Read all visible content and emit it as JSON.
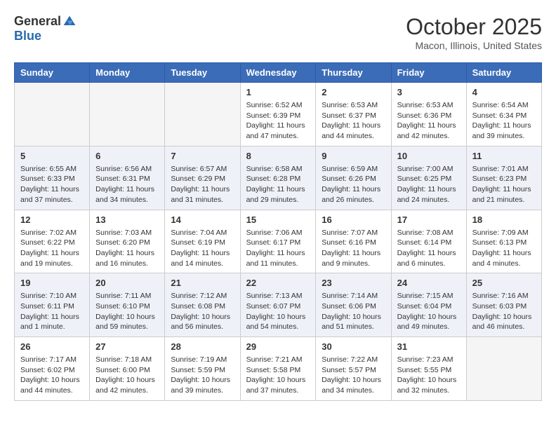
{
  "logo": {
    "general": "General",
    "blue": "Blue"
  },
  "title": "October 2025",
  "location": "Macon, Illinois, United States",
  "days_of_week": [
    "Sunday",
    "Monday",
    "Tuesday",
    "Wednesday",
    "Thursday",
    "Friday",
    "Saturday"
  ],
  "weeks": [
    [
      {
        "day": "",
        "info": ""
      },
      {
        "day": "",
        "info": ""
      },
      {
        "day": "",
        "info": ""
      },
      {
        "day": "1",
        "info": "Sunrise: 6:52 AM\nSunset: 6:39 PM\nDaylight: 11 hours and 47 minutes."
      },
      {
        "day": "2",
        "info": "Sunrise: 6:53 AM\nSunset: 6:37 PM\nDaylight: 11 hours and 44 minutes."
      },
      {
        "day": "3",
        "info": "Sunrise: 6:53 AM\nSunset: 6:36 PM\nDaylight: 11 hours and 42 minutes."
      },
      {
        "day": "4",
        "info": "Sunrise: 6:54 AM\nSunset: 6:34 PM\nDaylight: 11 hours and 39 minutes."
      }
    ],
    [
      {
        "day": "5",
        "info": "Sunrise: 6:55 AM\nSunset: 6:33 PM\nDaylight: 11 hours and 37 minutes."
      },
      {
        "day": "6",
        "info": "Sunrise: 6:56 AM\nSunset: 6:31 PM\nDaylight: 11 hours and 34 minutes."
      },
      {
        "day": "7",
        "info": "Sunrise: 6:57 AM\nSunset: 6:29 PM\nDaylight: 11 hours and 31 minutes."
      },
      {
        "day": "8",
        "info": "Sunrise: 6:58 AM\nSunset: 6:28 PM\nDaylight: 11 hours and 29 minutes."
      },
      {
        "day": "9",
        "info": "Sunrise: 6:59 AM\nSunset: 6:26 PM\nDaylight: 11 hours and 26 minutes."
      },
      {
        "day": "10",
        "info": "Sunrise: 7:00 AM\nSunset: 6:25 PM\nDaylight: 11 hours and 24 minutes."
      },
      {
        "day": "11",
        "info": "Sunrise: 7:01 AM\nSunset: 6:23 PM\nDaylight: 11 hours and 21 minutes."
      }
    ],
    [
      {
        "day": "12",
        "info": "Sunrise: 7:02 AM\nSunset: 6:22 PM\nDaylight: 11 hours and 19 minutes."
      },
      {
        "day": "13",
        "info": "Sunrise: 7:03 AM\nSunset: 6:20 PM\nDaylight: 11 hours and 16 minutes."
      },
      {
        "day": "14",
        "info": "Sunrise: 7:04 AM\nSunset: 6:19 PM\nDaylight: 11 hours and 14 minutes."
      },
      {
        "day": "15",
        "info": "Sunrise: 7:06 AM\nSunset: 6:17 PM\nDaylight: 11 hours and 11 minutes."
      },
      {
        "day": "16",
        "info": "Sunrise: 7:07 AM\nSunset: 6:16 PM\nDaylight: 11 hours and 9 minutes."
      },
      {
        "day": "17",
        "info": "Sunrise: 7:08 AM\nSunset: 6:14 PM\nDaylight: 11 hours and 6 minutes."
      },
      {
        "day": "18",
        "info": "Sunrise: 7:09 AM\nSunset: 6:13 PM\nDaylight: 11 hours and 4 minutes."
      }
    ],
    [
      {
        "day": "19",
        "info": "Sunrise: 7:10 AM\nSunset: 6:11 PM\nDaylight: 11 hours and 1 minute."
      },
      {
        "day": "20",
        "info": "Sunrise: 7:11 AM\nSunset: 6:10 PM\nDaylight: 10 hours and 59 minutes."
      },
      {
        "day": "21",
        "info": "Sunrise: 7:12 AM\nSunset: 6:08 PM\nDaylight: 10 hours and 56 minutes."
      },
      {
        "day": "22",
        "info": "Sunrise: 7:13 AM\nSunset: 6:07 PM\nDaylight: 10 hours and 54 minutes."
      },
      {
        "day": "23",
        "info": "Sunrise: 7:14 AM\nSunset: 6:06 PM\nDaylight: 10 hours and 51 minutes."
      },
      {
        "day": "24",
        "info": "Sunrise: 7:15 AM\nSunset: 6:04 PM\nDaylight: 10 hours and 49 minutes."
      },
      {
        "day": "25",
        "info": "Sunrise: 7:16 AM\nSunset: 6:03 PM\nDaylight: 10 hours and 46 minutes."
      }
    ],
    [
      {
        "day": "26",
        "info": "Sunrise: 7:17 AM\nSunset: 6:02 PM\nDaylight: 10 hours and 44 minutes."
      },
      {
        "day": "27",
        "info": "Sunrise: 7:18 AM\nSunset: 6:00 PM\nDaylight: 10 hours and 42 minutes."
      },
      {
        "day": "28",
        "info": "Sunrise: 7:19 AM\nSunset: 5:59 PM\nDaylight: 10 hours and 39 minutes."
      },
      {
        "day": "29",
        "info": "Sunrise: 7:21 AM\nSunset: 5:58 PM\nDaylight: 10 hours and 37 minutes."
      },
      {
        "day": "30",
        "info": "Sunrise: 7:22 AM\nSunset: 5:57 PM\nDaylight: 10 hours and 34 minutes."
      },
      {
        "day": "31",
        "info": "Sunrise: 7:23 AM\nSunset: 5:55 PM\nDaylight: 10 hours and 32 minutes."
      },
      {
        "day": "",
        "info": ""
      }
    ]
  ]
}
